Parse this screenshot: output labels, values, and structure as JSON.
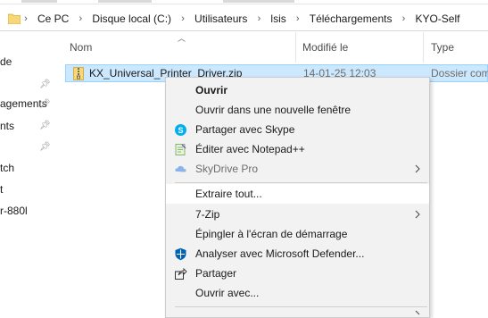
{
  "breadcrumb": {
    "items": [
      "Ce PC",
      "Disque local (C:)",
      "Utilisateurs",
      "lsis",
      "Téléchargements",
      "KYO-Self"
    ]
  },
  "nav": {
    "items": [
      {
        "label": "de",
        "pinned": false
      },
      {
        "label": "",
        "pinned": true
      },
      {
        "label": "agements",
        "pinned": true
      },
      {
        "label": "nts",
        "pinned": true
      },
      {
        "label": "",
        "pinned": true
      },
      {
        "label": "tch",
        "pinned": false
      },
      {
        "label": "t",
        "pinned": false
      },
      {
        "label": "r-880l",
        "pinned": false
      }
    ]
  },
  "columns": {
    "name": "Nom",
    "modified": "Modifié le",
    "type": "Type"
  },
  "file": {
    "name": "KX_Universal_Printer_Driver.zip",
    "date": "14-01-25 12:03",
    "type": "Dossier comp"
  },
  "context_menu": {
    "items": [
      {
        "label": "Ouvrir",
        "bold": true
      },
      {
        "label": "Ouvrir dans une nouvelle fenêtre"
      },
      {
        "label": "Partager avec Skype",
        "icon": "skype-icon"
      },
      {
        "label": "Éditer avec Notepad++",
        "icon": "notepadplusplus-icon"
      },
      {
        "label": "SkyDrive Pro",
        "icon": "skydrive-icon",
        "disabled": true,
        "submenu": true
      },
      {
        "label": "Extraire tout...",
        "highlighted": true
      },
      {
        "label": "7-Zip",
        "submenu": true
      },
      {
        "label": "Épingler à l'écran de démarrage"
      },
      {
        "label": "Analyser avec Microsoft Defender...",
        "icon": "defender-shield-icon"
      },
      {
        "label": "Partager",
        "icon": "share-icon"
      },
      {
        "label": "Ouvrir avec..."
      }
    ]
  },
  "colors": {
    "selection": "#cce8ff",
    "selection_border": "#99d1ff",
    "menu_background": "#f2f2f2",
    "skype_blue": "#00aff0",
    "defender_blue": "#0063b1",
    "folder_yellow": "#f8d775"
  }
}
